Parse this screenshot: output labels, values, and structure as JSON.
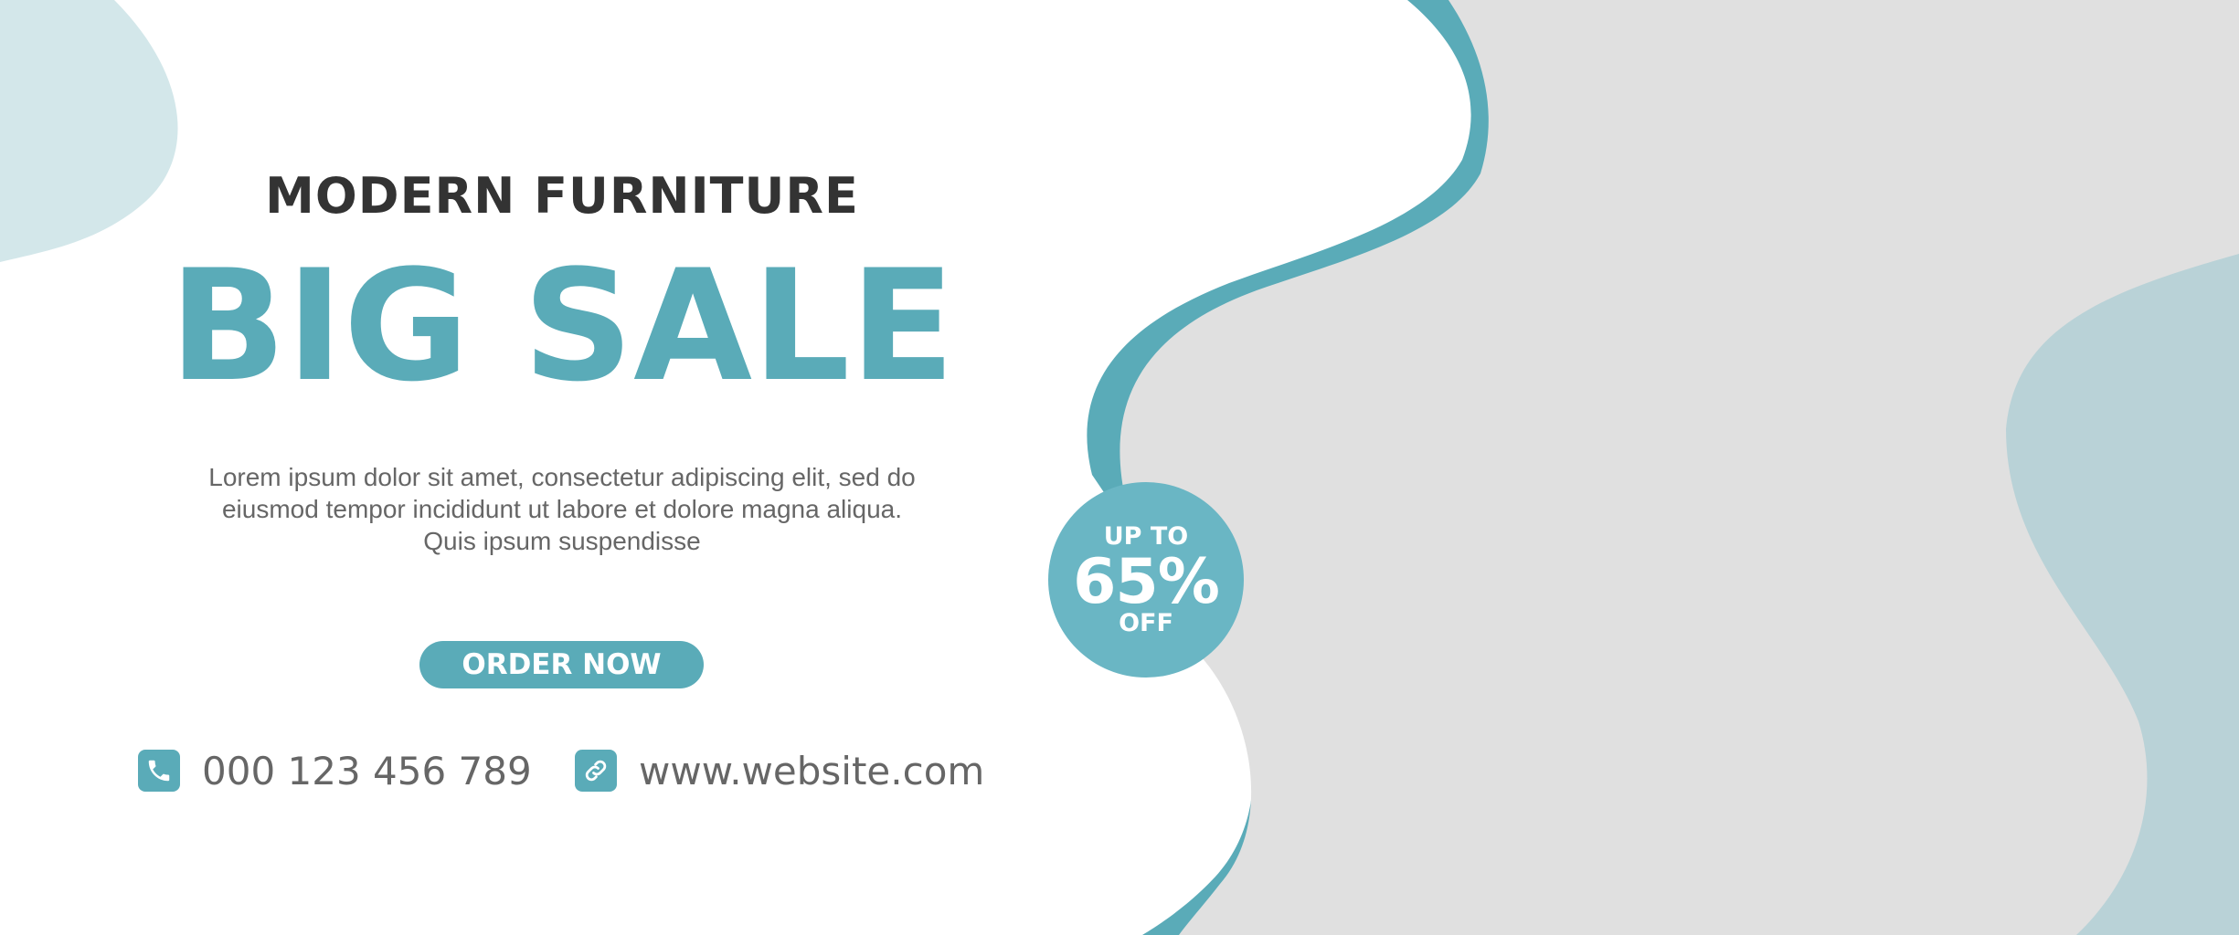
{
  "banner": {
    "subtitle": "MODERN FURNITURE",
    "headline": "BIG SALE",
    "description_lines": [
      "Lorem ipsum dolor sit amet, consectetur adipiscing elit, sed do",
      "eiusmod tempor incididunt ut labore et dolore magna aliqua.",
      "Quis ipsum suspendisse"
    ],
    "cta_label": "ORDER NOW"
  },
  "badge": {
    "top_text": "UP TO",
    "value": "65%",
    "bottom_text": "OFF"
  },
  "contact": {
    "phone": "000 123 456 789",
    "phone_icon": "phone-icon",
    "website": "www.website.com",
    "website_icon": "link-icon"
  },
  "colors": {
    "accent": "#5aabb8",
    "badge": "#6ab6c4",
    "text_dark": "#333333",
    "text_muted": "#666666",
    "photo_placeholder": "#e0e0e0",
    "blob_light": "#d3e7ea",
    "blob_right": "#b9d2d7"
  }
}
